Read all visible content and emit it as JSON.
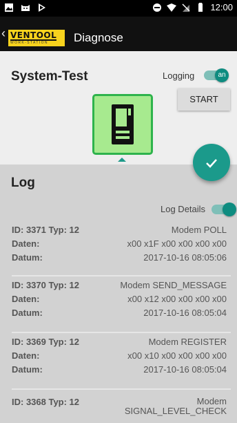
{
  "status_bar": {
    "time": "12:00"
  },
  "toolbar": {
    "logo_text": "VENTOOL",
    "logo_sub": "WORK-STATION",
    "title": "Diagnose"
  },
  "system_test": {
    "title": "System-Test",
    "logging_label": "Logging",
    "logging_toggle": "an",
    "start_label": "START"
  },
  "log": {
    "title": "Log",
    "details_label": "Log Details",
    "entries": [
      {
        "id_label": "ID: 3371 Typ: 12",
        "message": "Modem POLL",
        "daten_label": "Daten:",
        "daten": "x00 x1F x00 x00 x00 x00",
        "datum_label": "Datum:",
        "datum": "2017-10-16 08:05:06"
      },
      {
        "id_label": "ID: 3370 Typ: 12",
        "message": "Modem SEND_MESSAGE",
        "daten_label": "Daten:",
        "daten": "x00 x12 x00 x00 x00 x00",
        "datum_label": "Datum:",
        "datum": "2017-10-16 08:05:04"
      },
      {
        "id_label": "ID: 3369 Typ: 12",
        "message": "Modem REGISTER",
        "daten_label": "Daten:",
        "daten": "x00 x10 x00 x00 x00 x00",
        "datum_label": "Datum:",
        "datum": "2017-10-16 08:05:04"
      },
      {
        "id_label": "ID: 3368 Typ: 12",
        "message": "Modem SIGNAL_LEVEL_CHECK"
      }
    ]
  },
  "colors": {
    "accent": "#1b9a8b",
    "tile_green": "#a7ea8f",
    "logo_yellow": "#f7d21d"
  },
  "icons": [
    "image-icon",
    "cat-icon",
    "play-store-icon",
    "minus-circle-icon",
    "wifi-icon",
    "no-sim-icon",
    "battery-icon",
    "back-arrow-icon",
    "vending-machine-icon",
    "check-icon"
  ]
}
